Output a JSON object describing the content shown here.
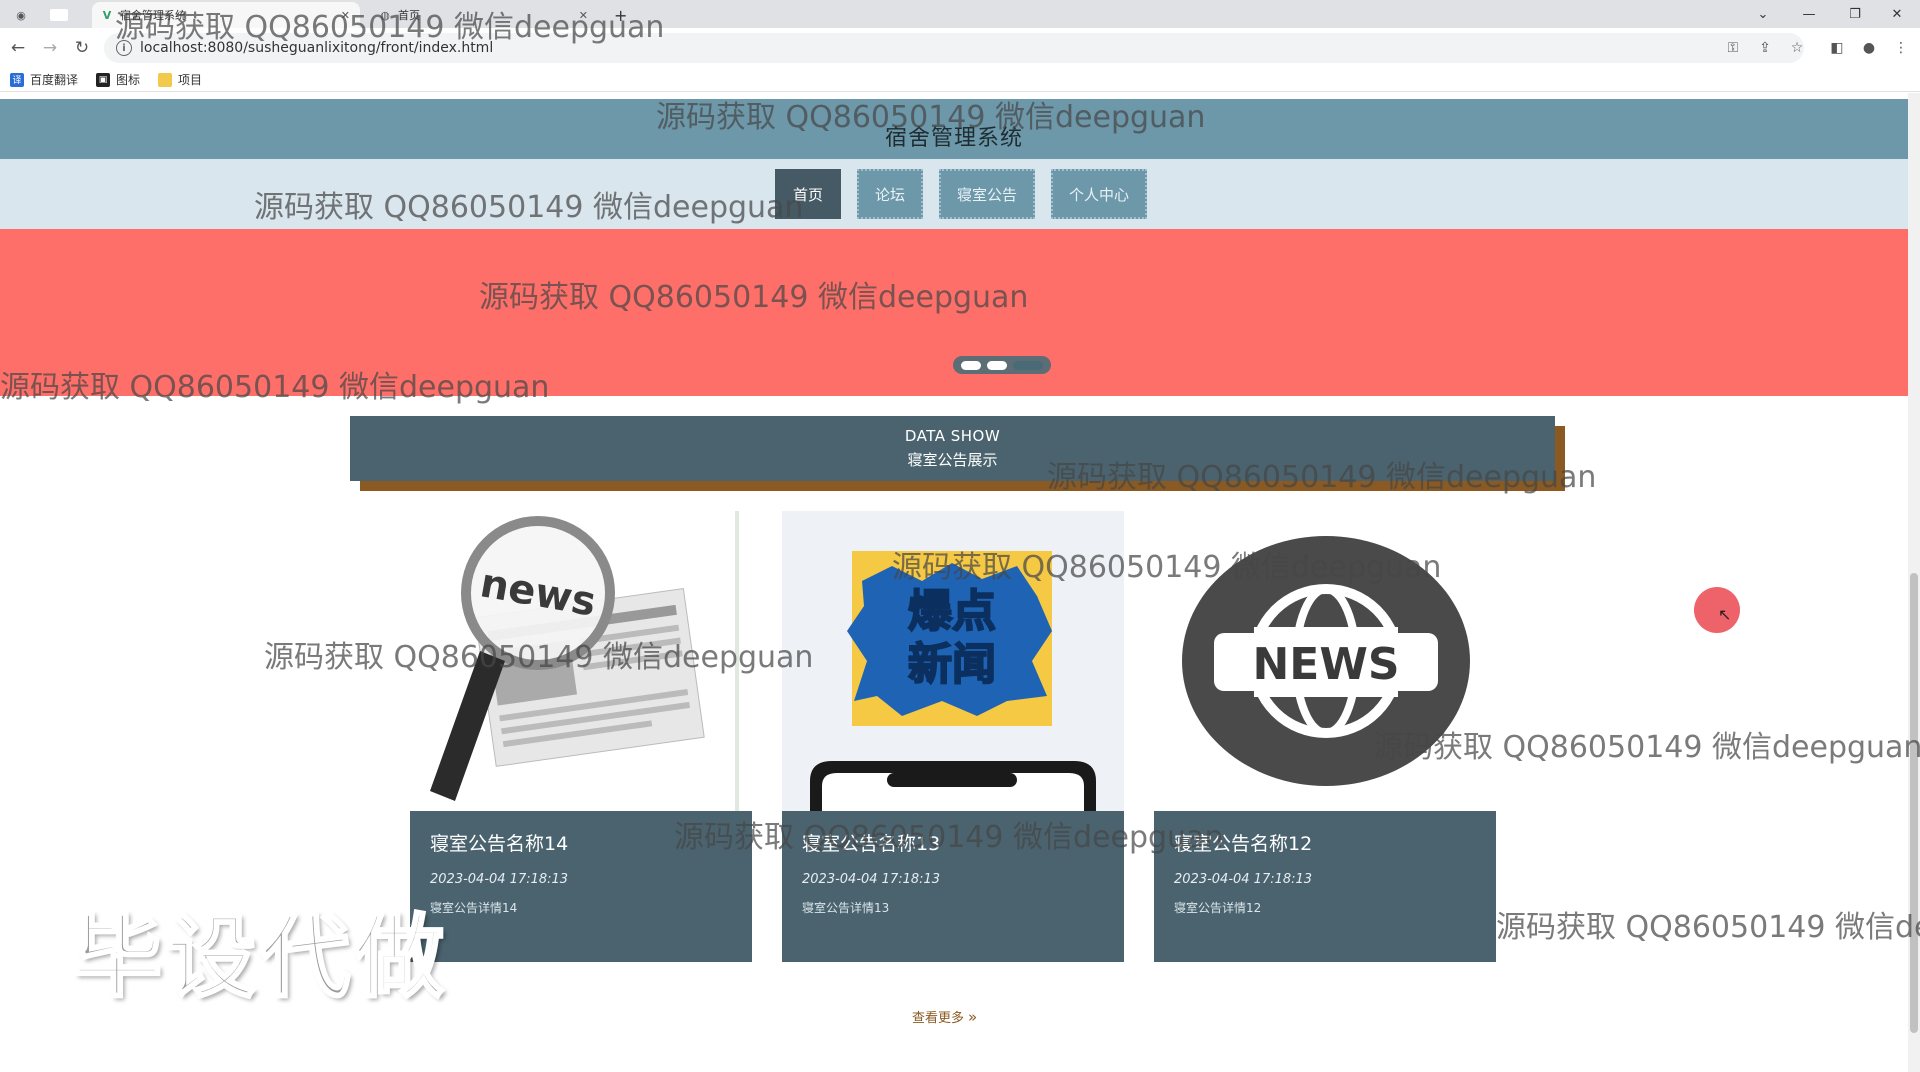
{
  "browser": {
    "tabs": [
      {
        "label": "宿舍管理系统",
        "icon": "vue-icon"
      },
      {
        "label": "首页",
        "icon": "globe-icon"
      }
    ],
    "new_tab": "+",
    "url": "localhost:8080/susheguanlixitong/front/index.html",
    "bookmarks": [
      {
        "label": "百度翻译",
        "icon": "translate-icon",
        "color": "#2b6cd8"
      },
      {
        "label": "图标",
        "icon": "image-icon",
        "color": "#222222"
      },
      {
        "label": "项目",
        "icon": "folder-icon",
        "color": "#f2c94c"
      }
    ]
  },
  "site": {
    "title": "宿舍管理系统",
    "nav": [
      {
        "label": "首页",
        "active": true
      },
      {
        "label": "论坛",
        "active": false
      },
      {
        "label": "寝室公告",
        "active": false
      },
      {
        "label": "个人中心",
        "active": false
      }
    ],
    "banner_color": "#ff6f69",
    "carousel": {
      "total": 3,
      "active_index": 2
    },
    "section": {
      "en": "DATA SHOW",
      "cn": "寝室公告展示"
    },
    "cards": [
      {
        "name": "寝室公告名称14",
        "time": "2023-04-04 17:18:13",
        "detail": "寝室公告详情14",
        "image": "news-magnifier-image"
      },
      {
        "name": "寝室公告名称13",
        "time": "2023-04-04 17:18:13",
        "detail": "寝室公告详情13",
        "image": "breaking-news-phone-image"
      },
      {
        "name": "寝室公告名称12",
        "time": "2023-04-04 17:18:13",
        "detail": "寝室公告详情12",
        "image": "news-globe-image"
      }
    ],
    "more_label": "查看更多",
    "accent_color": "#4a636e",
    "nav_color": "#6d98aa"
  },
  "overlay": {
    "watermark": "源码获取 QQ86050149 微信deepguan",
    "big_stamp": "毕设代做"
  },
  "globe_label": "NEWS",
  "news_label": "news",
  "breaking": {
    "line1": "爆点",
    "line2": "新闻"
  }
}
